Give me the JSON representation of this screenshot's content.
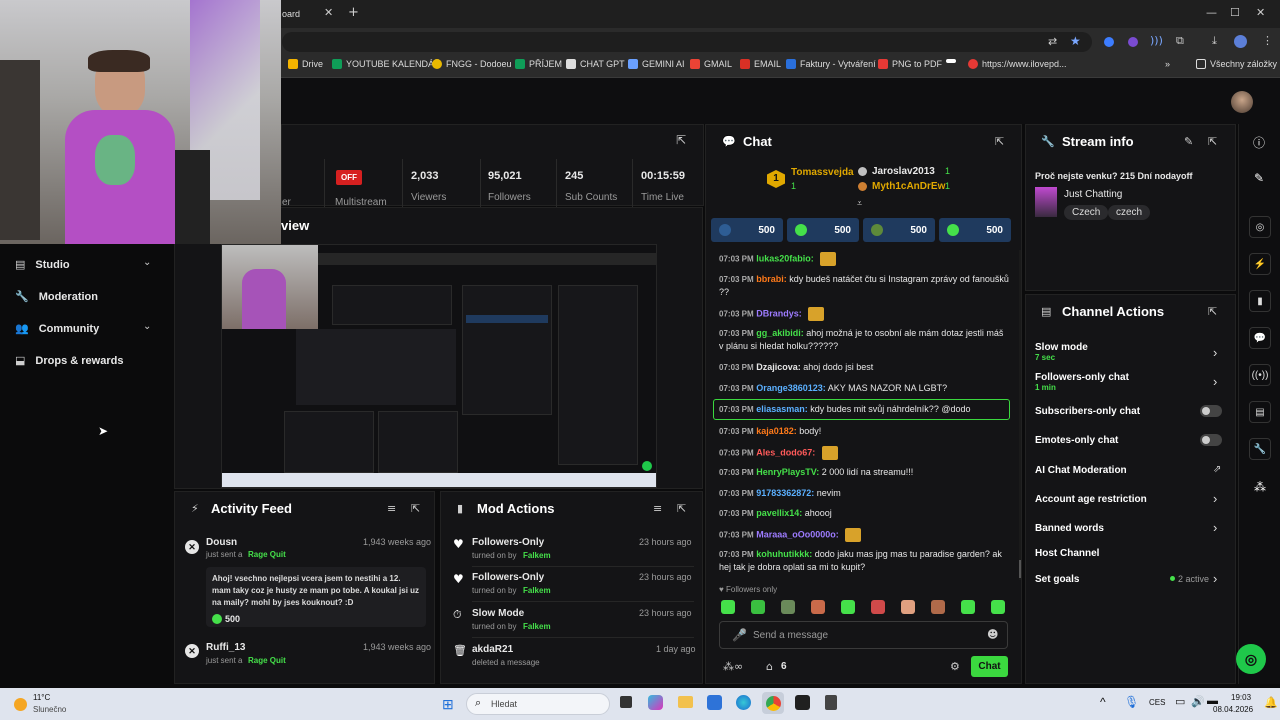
{
  "browser": {
    "tab_title_fragment": "oard",
    "bookmarks": [
      "Drive",
      "YOUTUBE KALENDÁŘ",
      "FNGG - Dodoeu",
      "PŘÍJEM",
      "CHAT GPT",
      "GEMINI AI",
      "GMAIL",
      "EMAIL",
      "Faktury - Vytváření",
      "PNG to PDF",
      "https://www.ilovepd...",
      "Všechny záložky"
    ]
  },
  "sidebar": {
    "items": [
      {
        "label": "Studio",
        "icon": "studio-icon",
        "expandable": true
      },
      {
        "label": "Moderation",
        "icon": "wrench-icon",
        "expandable": false
      },
      {
        "label": "Community",
        "icon": "people-icon",
        "expandable": true
      },
      {
        "label": "Drops & rewards",
        "icon": "gift-icon",
        "expandable": false
      }
    ]
  },
  "stats": {
    "status_badge": "OFF",
    "status_label": "Multistream",
    "partial_label": "er",
    "items": [
      {
        "value": "2,033",
        "label": "Viewers"
      },
      {
        "value": "95,021",
        "label": "Followers"
      },
      {
        "value": "245",
        "label": "Sub Counts"
      },
      {
        "value": "00:15:59",
        "label": "Time Live"
      }
    ]
  },
  "preview": {
    "title_fragment": "view"
  },
  "activity_feed": {
    "title": "Activity Feed",
    "items": [
      {
        "user": "Dousn",
        "action": "just sent a",
        "reward": "Rage Quit",
        "time": "1,943 weeks ago",
        "message": "Ahoj! vsechno nejlepsi vcera jsem to nestihi a 12. mam taky coz je husty ze mam po tobe. A koukal jsi uz na maily? mohl by jses kouknout? :D",
        "amount": "500"
      },
      {
        "user": "Ruffi_13",
        "action": "just sent a",
        "reward": "Rage Quit",
        "time": "1,943 weeks ago"
      }
    ]
  },
  "mod_actions": {
    "title": "Mod Actions",
    "items": [
      {
        "action": "Followers-Only",
        "sub": "turned on by",
        "by": "Falkem",
        "time": "23 hours ago",
        "icon": "heart-icon"
      },
      {
        "action": "Followers-Only",
        "sub": "turned on by",
        "by": "Falkem",
        "time": "23 hours ago",
        "icon": "heart-icon"
      },
      {
        "action": "Slow Mode",
        "sub": "turned on by",
        "by": "Falkem",
        "time": "23 hours ago",
        "icon": "slow-icon"
      },
      {
        "action": "akdaR21",
        "sub": "deleted a message",
        "by": "",
        "time": "1 day ago",
        "icon": "trash-icon"
      }
    ]
  },
  "chat": {
    "title": "Chat",
    "leaders": [
      {
        "rank": "1",
        "name": "Tomassvejda",
        "count": "1"
      },
      {
        "rank": "",
        "name": "Jaroslav2013",
        "count": "1"
      },
      {
        "rank": "",
        "name": "Myth1cAnDrEw",
        "count": "1"
      }
    ],
    "bubbles": [
      "500",
      "500",
      "500",
      "500"
    ],
    "messages": [
      {
        "time": "07:03 PM",
        "user": "lukas20fabio:",
        "text": "",
        "color": "#45e04a",
        "emote": true
      },
      {
        "time": "07:03 PM",
        "user": "bbrabi:",
        "text": "kdy budeš natáčet čtu si Instagram zprávy od fanoušků ??",
        "color": "#ff7a1a"
      },
      {
        "time": "07:03 PM",
        "user": "DBrandys:",
        "text": "",
        "color": "#9d7bff",
        "emote": true
      },
      {
        "time": "07:03 PM",
        "user": "gg_akibidi:",
        "text": "ahoj možná je to osobní ale mám dotaz jestli máš v plánu si hledat holku??????",
        "color": "#45e04a"
      },
      {
        "time": "07:03 PM",
        "user": "Dzajicova:",
        "text": "ahoj dodo jsi best",
        "color": "#e6e6e6"
      },
      {
        "time": "07:03 PM",
        "user": "Orange3860123:",
        "text": "AKY MAS NAZOR NA LGBT?",
        "color": "#5bb0ff"
      },
      {
        "time": "07:03 PM",
        "user": "eliasasman:",
        "text": "kdy budes mit svůj náhrdelník?? @dodo",
        "color": "#5bb0ff",
        "highlight": true
      },
      {
        "time": "07:03 PM",
        "user": "kaja0182:",
        "text": "body!",
        "color": "#ff7a1a"
      },
      {
        "time": "07:03 PM",
        "user": "Ales_dodo67:",
        "text": "",
        "color": "#ff5a5a",
        "emote": true
      },
      {
        "time": "07:03 PM",
        "user": "HenryPlaysTV:",
        "text": "2 000 lidí na streamu!!!",
        "color": "#45e04a"
      },
      {
        "time": "07:03 PM",
        "user": "91783362872:",
        "text": "nevim",
        "color": "#5bb0ff"
      },
      {
        "time": "07:03 PM",
        "user": "pavellix14:",
        "text": "ahoooj",
        "color": "#45e04a"
      },
      {
        "time": "07:03 PM",
        "user": "Maraaa_oOo0000o:",
        "text": "",
        "color": "#9d7bff",
        "emote": true
      },
      {
        "time": "07:03 PM",
        "user": "kohuhutikkk:",
        "text": "dodo jaku mas jpg mas tu paradise garden? ak hej tak je dobra oplati sa mi to kupit?",
        "color": "#45e04a"
      }
    ],
    "followers_only": "Followers only",
    "placeholder": "Send a message",
    "viewer_count": "6",
    "chat_button": "Chat"
  },
  "stream_info": {
    "title": "Stream info",
    "stream_title": "Proč nejste venku? 215 Dní nodayoff",
    "category": "Just Chatting",
    "tags": [
      "Czech",
      "czech"
    ]
  },
  "channel_actions": {
    "title": "Channel Actions",
    "rows": [
      {
        "label": "Slow mode",
        "sub": "7 sec",
        "control": "chevron"
      },
      {
        "label": "Followers-only chat",
        "sub": "1 min",
        "control": "chevron"
      },
      {
        "label": "Subscribers-only chat",
        "sub": "",
        "control": "toggle"
      },
      {
        "label": "Emotes-only chat",
        "sub": "",
        "control": "toggle"
      },
      {
        "label": "AI Chat Moderation",
        "sub": "",
        "control": "external"
      },
      {
        "label": "Account age restriction",
        "sub": "",
        "control": "chevron"
      },
      {
        "label": "Banned words",
        "sub": "",
        "control": "chevron"
      },
      {
        "label": "Host Channel",
        "sub": "",
        "control": "none"
      },
      {
        "label": "Set goals",
        "sub": "",
        "control": "chevron",
        "extra": "2 active"
      }
    ]
  },
  "taskbar": {
    "weather_temp": "11°C",
    "weather_desc": "Slunečno",
    "search_placeholder": "Hledat",
    "lang": "CES",
    "time": "19:03",
    "date": "08.04.2026"
  }
}
